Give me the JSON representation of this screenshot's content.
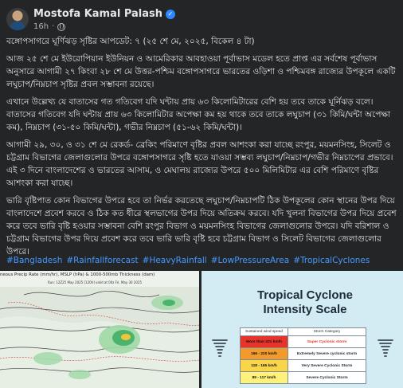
{
  "author": {
    "name": "Mostofa Kamal Palash",
    "time": "16h",
    "verified_icon": "verified-badge-icon",
    "privacy_icon": "globe-icon"
  },
  "post": {
    "paragraphs": [
      "বঙ্গোপসাগরে ঘূর্ণিঝড় সৃষ্টির আপডেট: ৭ (২৫ শে মে, ২০২৫, বিকেল ৪ টা)",
      "আজ ২৫ শে মে ইউরোপিয়ান ইউনিয়ন ও আমেরিকার আবহাওয়া পূর্বাভাস মডেল হতে প্রাপ্ত এর সর্বশেষ পূর্বাভাস অনুসারে আগামী ২৭ কিংবা ২৮ শে মে উত্তর-পশ্চিম বঙ্গোপসাগরে ভারতের ওড়িশা ও পশ্চিমবঙ্গ রাজ্যের উপকূলে একটি লঘুচাপ/নিম্নচাপ সৃষ্টির প্রবল সম্ভাবনা রয়েছে।",
      "এখানে উল্লেখ্য যে বাতাসের গত গতিবেগ যদি ঘন্টায় প্রায় ৬৩ কিলোমিটারের বেশি হয় তবে তাকে ঘূর্নিঝড় বলে। বাতাসের গতিবেগ যদি ঘন্টায় প্রায় ৬৩ কিলোমিটার অপেক্ষা কম হয় থাকে তবে তাকে লঘুচাপ (৩১ কিমি/ঘন্টা অপেক্ষা কম), নিম্নচাপ (৩১-৫০ কিমি/ঘন্টা), গভীর নিম্নচাপ (৫১-৬২ কিমি/ঘন্টা)।",
      "আগামী ২৯, ৩০, ও ৩১ শে মে রেকর্ড- ব্রেকিং পরিমাণে বৃষ্টির প্রবল আশংকা করা যাচ্ছে রংপুর, ময়মনসিংহ, সিলেট ও চট্টগ্রাম বিভাগের জেলাগুলোর উপরে বঙ্গোপসাগরে সৃষ্টি হতে যাওয়া সম্ভব্য লঘুচাপ/নিম্নচাপ/গভীর নিম্নচাপের প্রভাবে। এই ৩ দিনে বাংলাদেশের ও ভারতের আসাম, ও মেঘালয় রাজ্যের উপরে ৫০০ মিলিমিটার এর বেশি পরিমাণে বৃষ্টির আশংকা করা যাচ্ছে।",
      "ভারি বৃষ্টিপাত কোন বিভাগের উপরে হবে তা নির্ভর করতেছে লঘুচাপ/নিম্নচাপটি ঠিক উপকূলের কোন স্থানের উপর দিয়ে বাংলাদেশে প্রবেশ করবে ও ঠিক কত ধীরে স্থলভাগের উপর দিয়ে অতিক্রম করবে। যদি খুলনা বিভাগের উপর দিয়ে প্রবেশ করে তবে ভারি বৃষ্টি হওয়ার সম্ভাবনা বেশি রংপুর বিভাগ ও ময়মনসিংহ বিভাগের জেলাগুলোর উপরে। যদি বরিশাল ও চট্টগ্রাম বিভাগের উপর দিয়ে প্রবেশ করে তবে ভারি ভারি বৃষ্টি হবে চট্টগ্রাম বিভাগ ও সিলেট বিভাগের জেলাগুলোর উপরে।"
    ],
    "hashtags": [
      "#Bangladesh",
      "#Rainfallforecast",
      "#HeavyRainfall",
      "#LowPressureArea",
      "#TropicalCyclones"
    ]
  },
  "map_image": {
    "title": "neous Precip Rate (mm/hr), MSLP (hPa) & 1000-500mb Thickness (dam)",
    "subtitle": "Run: 12Z25 May 2025 [120h] valid at 00z Fri, May 30 2025",
    "colors": {
      "land": "#dfe7dc",
      "rain_light": "#9fd8a5",
      "rain_mid": "#4bb36c",
      "rain_heavy": "#f0c53b",
      "isobar": "#444444",
      "thickness": "#d23a3a"
    }
  },
  "cyclone_scale": {
    "title": "Tropical Cyclone Intensity Scale",
    "headers": [
      "Sustained wind speed",
      "Storm Category"
    ],
    "rows": [
      {
        "speed": "More than 221 km/h",
        "category": "Super Cyclonic storm",
        "color": "#e8332a"
      },
      {
        "speed": "166 - 220 km/h",
        "category": "Extremely Severe cyclonic storm",
        "color": "#f39a2c"
      },
      {
        "speed": "118 - 165 km/h",
        "category": "Very Severe Cyclonic Storm",
        "color": "#f8d54a"
      },
      {
        "speed": "89 - 117 km/h",
        "category": "Severe Cyclonic Storm",
        "color": "#fff27a"
      }
    ],
    "icons": [
      "cyclone-icon",
      "cyclone-icon"
    ]
  }
}
